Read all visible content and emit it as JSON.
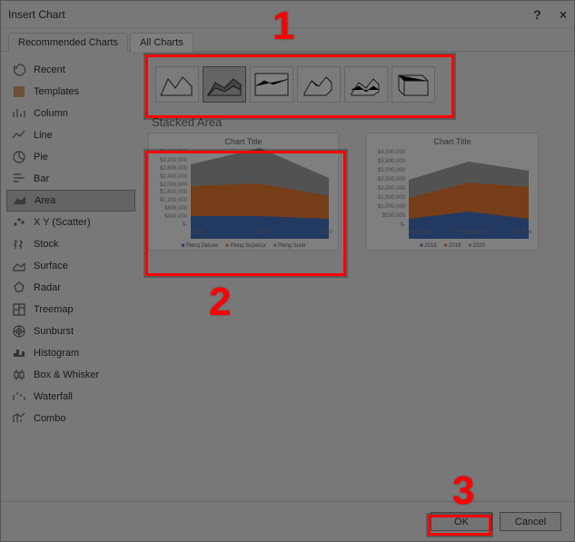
{
  "window": {
    "title": "Insert Chart"
  },
  "tabs": {
    "recommended": "Recommended Charts",
    "all": "All Charts"
  },
  "sidebar": {
    "items": [
      {
        "label": "Recent"
      },
      {
        "label": "Templates"
      },
      {
        "label": "Column"
      },
      {
        "label": "Line"
      },
      {
        "label": "Pie"
      },
      {
        "label": "Bar"
      },
      {
        "label": "Area"
      },
      {
        "label": "X Y (Scatter)"
      },
      {
        "label": "Stock"
      },
      {
        "label": "Surface"
      },
      {
        "label": "Radar"
      },
      {
        "label": "Treemap"
      },
      {
        "label": "Sunburst"
      },
      {
        "label": "Histogram"
      },
      {
        "label": "Box & Whisker"
      },
      {
        "label": "Waterfall"
      },
      {
        "label": "Combo"
      }
    ]
  },
  "heading": "Stacked Area",
  "callouts": {
    "c1": "1",
    "c2": "2",
    "c3": "3"
  },
  "buttons": {
    "ok": "OK",
    "cancel": "Cancel"
  },
  "chart_data": [
    {
      "type": "area",
      "stacked": true,
      "title": "Chart Title",
      "categories": [
        "2018",
        "2019",
        "2020"
      ],
      "series": [
        {
          "name": "Pking Deluxe",
          "values": [
            900000,
            900000,
            800000
          ]
        },
        {
          "name": "Pking Superior",
          "values": [
            1200000,
            1300000,
            900000
          ]
        },
        {
          "name": "Pking Suite",
          "values": [
            900000,
            1400000,
            700000
          ]
        }
      ],
      "ylabel": "",
      "xlabel": "",
      "ylim": [
        0,
        3600000
      ],
      "yticks": [
        "$3,600,000",
        "$3,200,000",
        "$2,800,000",
        "$2,400,000",
        "$2,000,000",
        "$1,600,000",
        "$1,200,000",
        "$800,000",
        "$400,000",
        "$-"
      ]
    },
    {
      "type": "area",
      "stacked": true,
      "title": "Chart Title",
      "categories": [
        "Pking Deluxe",
        "Pking Superior",
        "Pking Suite"
      ],
      "series": [
        {
          "name": "2018",
          "values": [
            900000,
            1200000,
            900000
          ]
        },
        {
          "name": "2019",
          "values": [
            900000,
            1300000,
            1400000
          ]
        },
        {
          "name": "2020",
          "values": [
            800000,
            900000,
            700000
          ]
        }
      ],
      "ylabel": "",
      "xlabel": "",
      "ylim": [
        0,
        4000000
      ],
      "yticks": [
        "$4,000,000",
        "$3,500,000",
        "$3,000,000",
        "$2,500,000",
        "$2,000,000",
        "$1,500,000",
        "$1,000,000",
        "$500,000",
        "$-"
      ],
      "legend": [
        "2018",
        "2019",
        "2020"
      ]
    }
  ]
}
